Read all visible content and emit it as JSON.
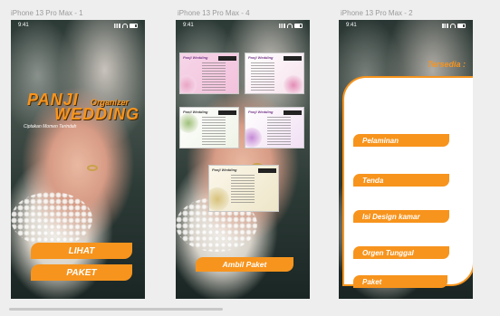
{
  "frames": [
    {
      "label": "iPhone 13 Pro Max - 1",
      "time": "9:41",
      "brand_line1": "PANJI",
      "brand_organizer": "Organizer",
      "brand_line2": "WEDDING",
      "tagline": "Ciptakan Momen Terindah",
      "buttons": [
        "LIHAT",
        "PAKET"
      ]
    },
    {
      "label": "iPhone 13 Pro Max - 4",
      "time": "9:41",
      "card_title": "Panji Wedding",
      "cta": "Ambil Paket"
    },
    {
      "label": "iPhone 13 Pro Max - 2",
      "time": "9:41",
      "heading": "Tersedia :",
      "options": [
        "Pelaminan",
        "Tenda",
        "Isi Design kamar",
        "Orgen Tunggal",
        "Paket"
      ]
    }
  ],
  "colors": {
    "accent": "#f7941d",
    "panel": "#ffffff",
    "canvas": "#eeeeee"
  },
  "icons": [
    "signal-icon",
    "wifi-icon",
    "battery-icon"
  ]
}
